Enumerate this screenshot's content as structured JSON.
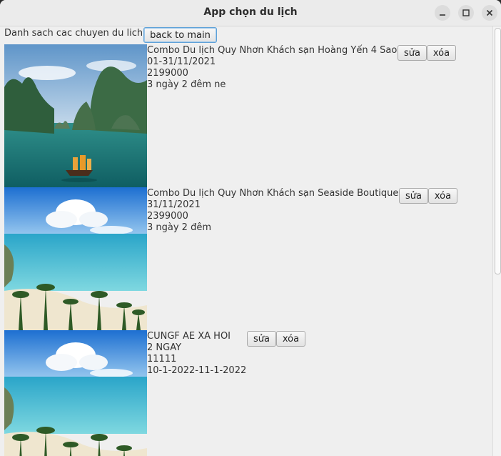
{
  "window": {
    "title": "App chọn du lịch"
  },
  "header": {
    "label": "Danh sach cac chuyen du lich",
    "back_button": "back to main"
  },
  "trips": [
    {
      "image": "ha-long-bay-photo",
      "name": "Combo Du lịch Quy Nhơn Khách sạn Hoàng Yến 4 Sao",
      "date": "01-31/11/2021",
      "price": "2199000",
      "duration": "3 ngày 2 đêm ne",
      "edit": "sửa",
      "delete": "xóa"
    },
    {
      "image": "tropical-beach-photo",
      "name": "Combo Du lịch Quy Nhơn Khách sạn Seaside Boutique",
      "date": "31/11/2021",
      "price": "2399000",
      "duration": "3 ngày 2 đêm",
      "edit": "sửa",
      "delete": "xóa"
    },
    {
      "image": "tropical-beach-photo",
      "name": "CUNGF AE XA HOI",
      "date": "2 NGAY",
      "price": "11111",
      "duration": "10-1-2022-11-1-2022",
      "edit": "sửa",
      "delete": "xóa"
    }
  ],
  "icons": {
    "minimize": "minimize-icon",
    "maximize": "maximize-icon",
    "close": "close-icon"
  },
  "colors": {
    "titlebar": "#ebebeb",
    "background": "#efefef",
    "focus": "#5ea1d8"
  }
}
